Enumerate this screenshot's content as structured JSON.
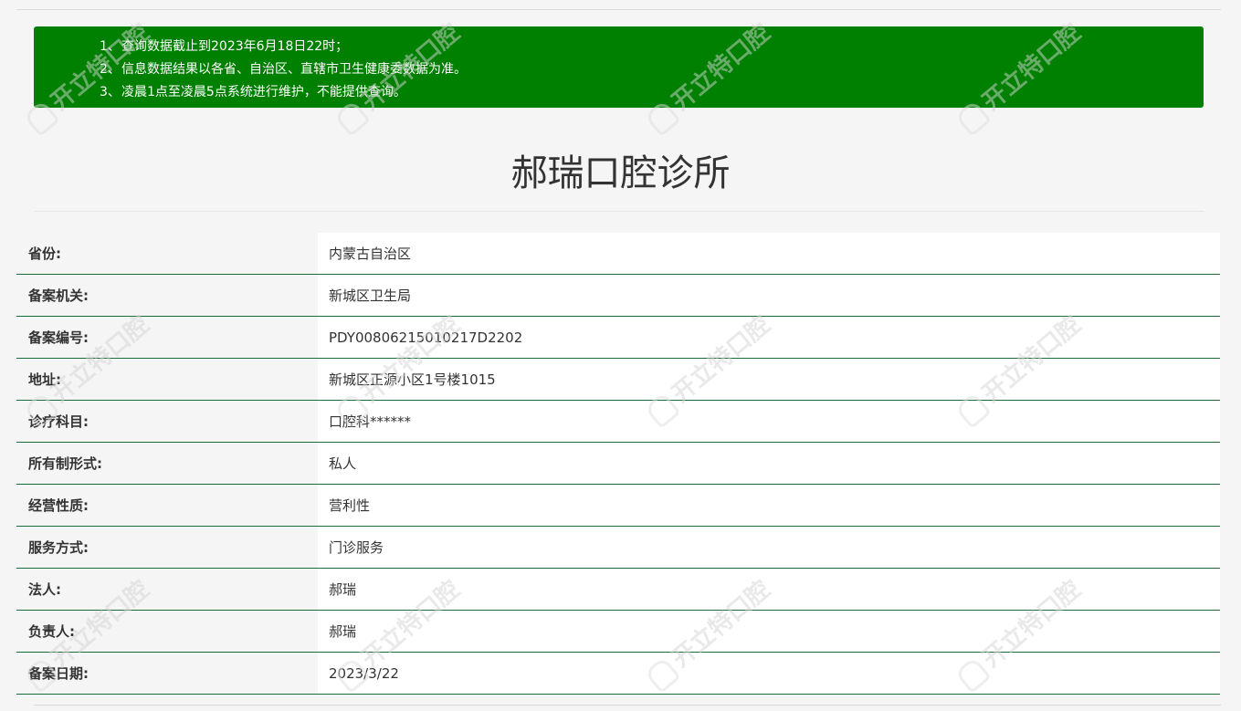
{
  "notice": {
    "lines": [
      {
        "num": "1、",
        "text": "查询数据截止到2023年6月18日22时；"
      },
      {
        "num": "2、",
        "text": "信息数据结果以各省、自治区、直辖市卫生健康委数据为准。"
      },
      {
        "num": "3、",
        "text": "凌晨1点至凌晨5点系统进行维护，不能提供查询。"
      }
    ]
  },
  "title": "郝瑞口腔诊所",
  "rows": [
    {
      "label": "省份:",
      "value": "内蒙古自治区"
    },
    {
      "label": "备案机关:",
      "value": "新城区卫生局"
    },
    {
      "label": "备案编号:",
      "value": "PDY00806215010217D2202"
    },
    {
      "label": "地址:",
      "value": "新城区正源小区1号楼1015"
    },
    {
      "label": "诊疗科目:",
      "value": "口腔科******"
    },
    {
      "label": "所有制形式:",
      "value": "私人"
    },
    {
      "label": "经营性质:",
      "value": "营利性"
    },
    {
      "label": "服务方式:",
      "value": "门诊服务"
    },
    {
      "label": "法人:",
      "value": "郝瑞"
    },
    {
      "label": "负责人:",
      "value": "郝瑞"
    },
    {
      "label": "备案日期:",
      "value": "2023/3/22"
    }
  ],
  "watermark": {
    "text": "开立特口腔",
    "icon": "tooth-logo-icon"
  },
  "colors": {
    "notice_bg": "#008000",
    "row_border": "#1e6b3a",
    "page_bg": "#f5f5f5"
  }
}
